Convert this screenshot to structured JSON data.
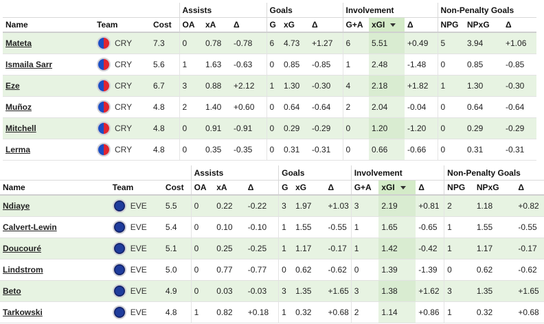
{
  "tables": [
    {
      "groups": [
        "Assists",
        "Goals",
        "Involvement",
        "Non-Penalty Goals"
      ],
      "columns": [
        "Name",
        "Team",
        "Cost",
        "OA",
        "xA",
        "Δ",
        "G",
        "xG",
        "Δ",
        "G+A",
        "xGI",
        "Δ",
        "NPG",
        "NPxG",
        "Δ"
      ],
      "rows": [
        {
          "name": "Mateta",
          "team": "CRY",
          "cost": "7.3",
          "oa": "0",
          "xa": "0.78",
          "da": "-0.78",
          "g": "6",
          "xg": "4.73",
          "dg": "+1.27",
          "ga": "6",
          "xgi": "5.51",
          "dgi": "+0.49",
          "npg": "5",
          "npxg": "3.94",
          "dnp": "+1.06"
        },
        {
          "name": "Ismaila Sarr",
          "team": "CRY",
          "cost": "5.6",
          "oa": "1",
          "xa": "1.63",
          "da": "-0.63",
          "g": "0",
          "xg": "0.85",
          "dg": "-0.85",
          "ga": "1",
          "xgi": "2.48",
          "dgi": "-1.48",
          "npg": "0",
          "npxg": "0.85",
          "dnp": "-0.85"
        },
        {
          "name": "Eze",
          "team": "CRY",
          "cost": "6.7",
          "oa": "3",
          "xa": "0.88",
          "da": "+2.12",
          "g": "1",
          "xg": "1.30",
          "dg": "-0.30",
          "ga": "4",
          "xgi": "2.18",
          "dgi": "+1.82",
          "npg": "1",
          "npxg": "1.30",
          "dnp": "-0.30"
        },
        {
          "name": "Muñoz",
          "team": "CRY",
          "cost": "4.8",
          "oa": "2",
          "xa": "1.40",
          "da": "+0.60",
          "g": "0",
          "xg": "0.64",
          "dg": "-0.64",
          "ga": "2",
          "xgi": "2.04",
          "dgi": "-0.04",
          "npg": "0",
          "npxg": "0.64",
          "dnp": "-0.64"
        },
        {
          "name": "Mitchell",
          "team": "CRY",
          "cost": "4.8",
          "oa": "0",
          "xa": "0.91",
          "da": "-0.91",
          "g": "0",
          "xg": "0.29",
          "dg": "-0.29",
          "ga": "0",
          "xgi": "1.20",
          "dgi": "-1.20",
          "npg": "0",
          "npxg": "0.29",
          "dnp": "-0.29"
        },
        {
          "name": "Lerma",
          "team": "CRY",
          "cost": "4.8",
          "oa": "0",
          "xa": "0.35",
          "da": "-0.35",
          "g": "0",
          "xg": "0.31",
          "dg": "-0.31",
          "ga": "0",
          "xgi": "0.66",
          "dgi": "-0.66",
          "npg": "0",
          "npxg": "0.31",
          "dnp": "-0.31"
        }
      ]
    },
    {
      "groups": [
        "Assists",
        "Goals",
        "Involvement",
        "Non-Penalty Goals"
      ],
      "columns": [
        "Name",
        "Team",
        "Cost",
        "OA",
        "xA",
        "Δ",
        "G",
        "xG",
        "Δ",
        "G+A",
        "xGI",
        "Δ",
        "NPG",
        "NPxG",
        "Δ"
      ],
      "rows": [
        {
          "name": "Ndiaye",
          "team": "EVE",
          "cost": "5.5",
          "oa": "0",
          "xa": "0.22",
          "da": "-0.22",
          "g": "3",
          "xg": "1.97",
          "dg": "+1.03",
          "ga": "3",
          "xgi": "2.19",
          "dgi": "+0.81",
          "npg": "2",
          "npxg": "1.18",
          "dnp": "+0.82"
        },
        {
          "name": "Calvert-Lewin",
          "team": "EVE",
          "cost": "5.4",
          "oa": "0",
          "xa": "0.10",
          "da": "-0.10",
          "g": "1",
          "xg": "1.55",
          "dg": "-0.55",
          "ga": "1",
          "xgi": "1.65",
          "dgi": "-0.65",
          "npg": "1",
          "npxg": "1.55",
          "dnp": "-0.55"
        },
        {
          "name": "Doucouré",
          "team": "EVE",
          "cost": "5.1",
          "oa": "0",
          "xa": "0.25",
          "da": "-0.25",
          "g": "1",
          "xg": "1.17",
          "dg": "-0.17",
          "ga": "1",
          "xgi": "1.42",
          "dgi": "-0.42",
          "npg": "1",
          "npxg": "1.17",
          "dnp": "-0.17"
        },
        {
          "name": "Lindstrom",
          "team": "EVE",
          "cost": "5.0",
          "oa": "0",
          "xa": "0.77",
          "da": "-0.77",
          "g": "0",
          "xg": "0.62",
          "dg": "-0.62",
          "ga": "0",
          "xgi": "1.39",
          "dgi": "-1.39",
          "npg": "0",
          "npxg": "0.62",
          "dnp": "-0.62"
        },
        {
          "name": "Beto",
          "team": "EVE",
          "cost": "4.9",
          "oa": "0",
          "xa": "0.03",
          "da": "-0.03",
          "g": "3",
          "xg": "1.35",
          "dg": "+1.65",
          "ga": "3",
          "xgi": "1.38",
          "dgi": "+1.62",
          "npg": "3",
          "npxg": "1.35",
          "dnp": "+1.65"
        },
        {
          "name": "Tarkowski",
          "team": "EVE",
          "cost": "4.8",
          "oa": "1",
          "xa": "0.82",
          "da": "+0.18",
          "g": "1",
          "xg": "0.32",
          "dg": "+0.68",
          "ga": "2",
          "xgi": "1.14",
          "dgi": "+0.86",
          "npg": "1",
          "npxg": "0.32",
          "dnp": "+0.68"
        }
      ]
    }
  ]
}
